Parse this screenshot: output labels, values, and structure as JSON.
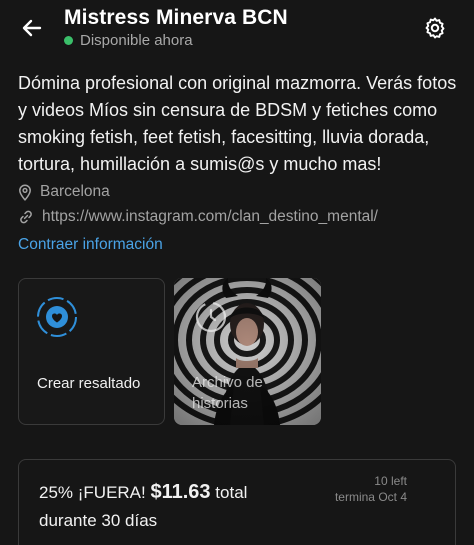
{
  "header": {
    "title": "Mistress Minerva BCN",
    "status": "Disponible ahora"
  },
  "colors": {
    "background": "#161616",
    "status_dot": "#3bbf6a",
    "link": "#4aa3e6",
    "accent_icon": "#2f8fd9"
  },
  "icons": {
    "back": "arrow-left-icon",
    "settings": "gear-icon",
    "location": "location-pin-icon",
    "link": "link-icon",
    "create_highlight": "heart-circle-icon",
    "archive": "clock-history-icon"
  },
  "bio": {
    "text": "Dómina profesional con original mazmorra. Verás fotos y videos Míos sin censura de BDSM y fetiches como smoking fetish, feet fetish, facesitting, lluvia dorada, tortura, humillación a sumis@s y mucho mas!",
    "location": "Barcelona",
    "link": "https://www.instagram.com/clan_destino_mental/",
    "collapse_label": "Contraer información"
  },
  "highlights": {
    "create_label": "Crear resaltado",
    "archive_label": "Archivo de historias"
  },
  "offer": {
    "discount": "25% ¡FUERA!",
    "price": "$11.63",
    "suffix": "total",
    "duration": "durante 30 días",
    "remaining": "10 left",
    "ends": "termina Oct 4"
  }
}
